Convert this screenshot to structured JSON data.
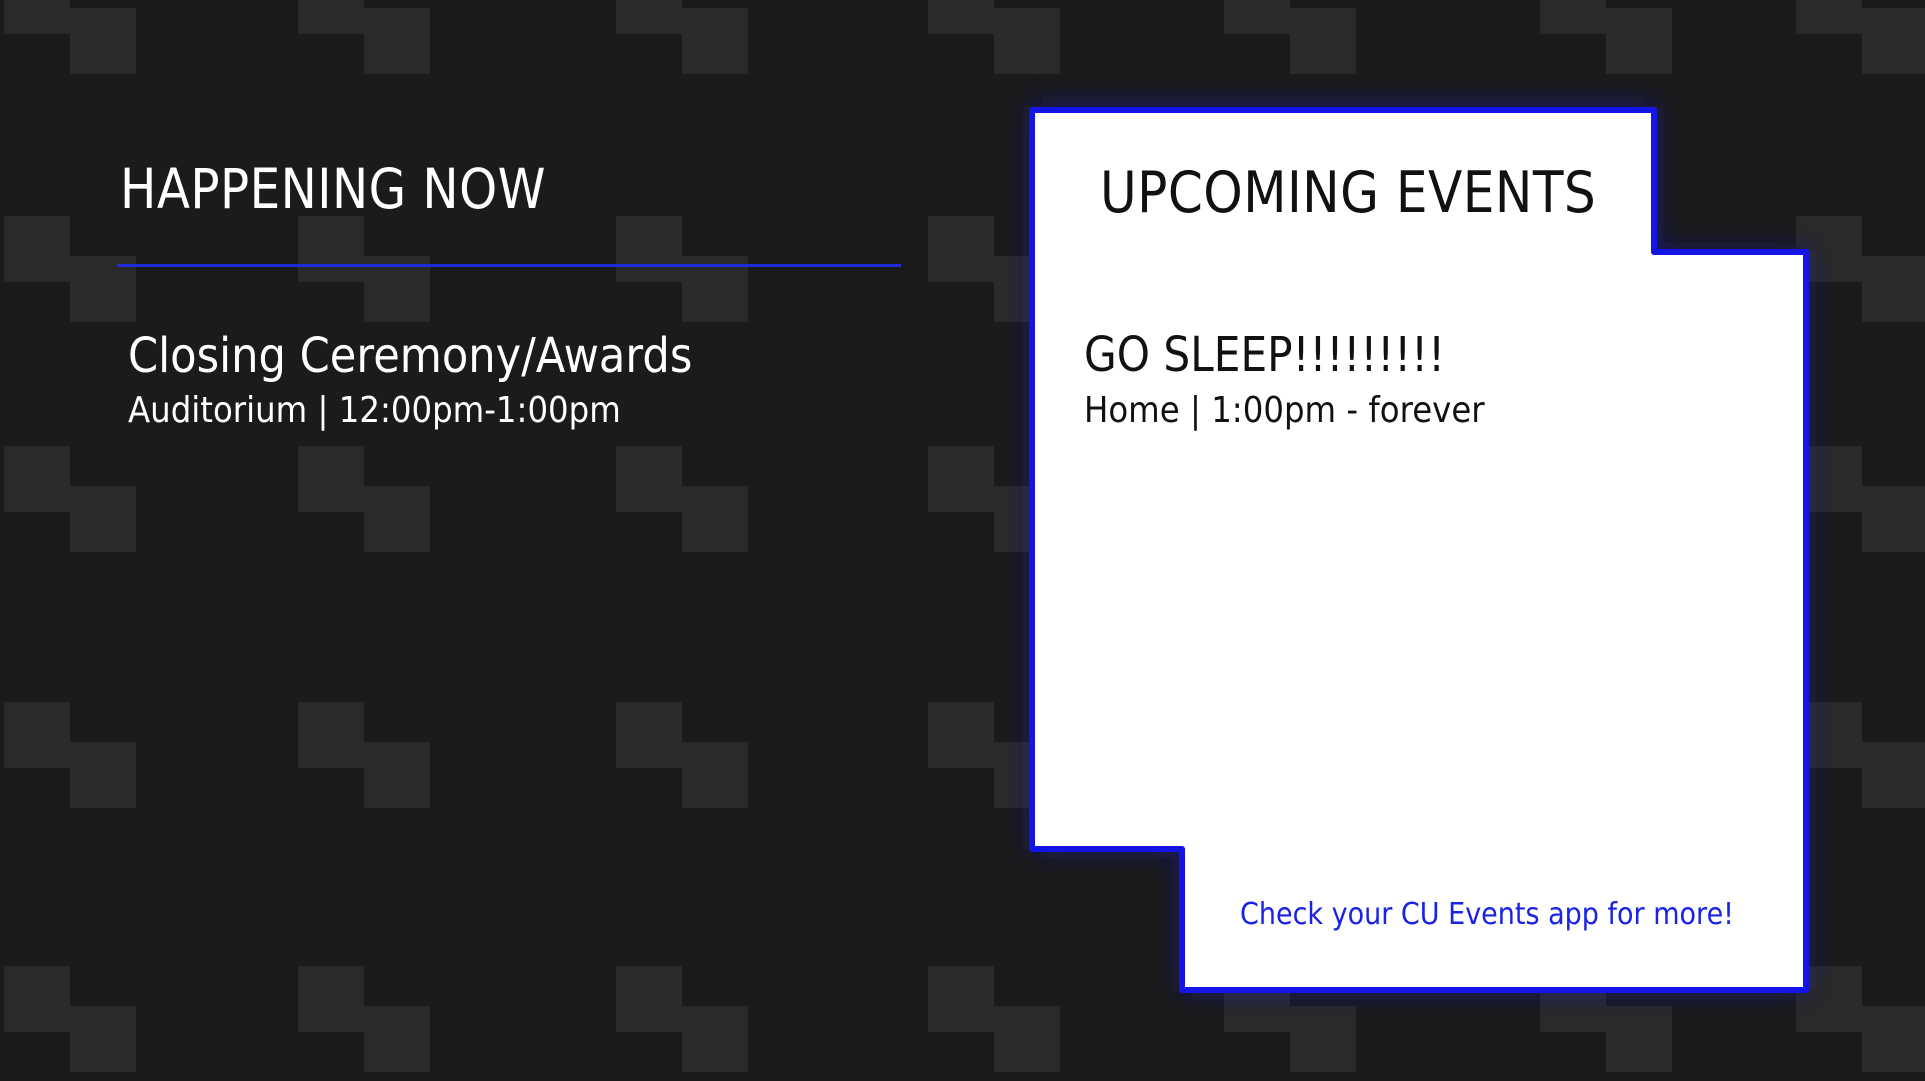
{
  "happening_now": {
    "heading": "HAPPENING NOW",
    "event_title": "Closing Ceremony/Awards",
    "event_detail": "Auditorium | 12:00pm-1:00pm"
  },
  "upcoming": {
    "heading": "UPCOMING EVENTS",
    "event_title": "GO SLEEP!!!!!!!!!",
    "event_detail": "Home | 1:00pm - forever",
    "cta_text": "Check your CU Events app for more!"
  },
  "colors": {
    "background": "#1b1b1b",
    "pattern": "#2a2a2a",
    "accent_blue": "#1f2bd6",
    "card": "#ffffff",
    "card_border": "#1414e6"
  }
}
